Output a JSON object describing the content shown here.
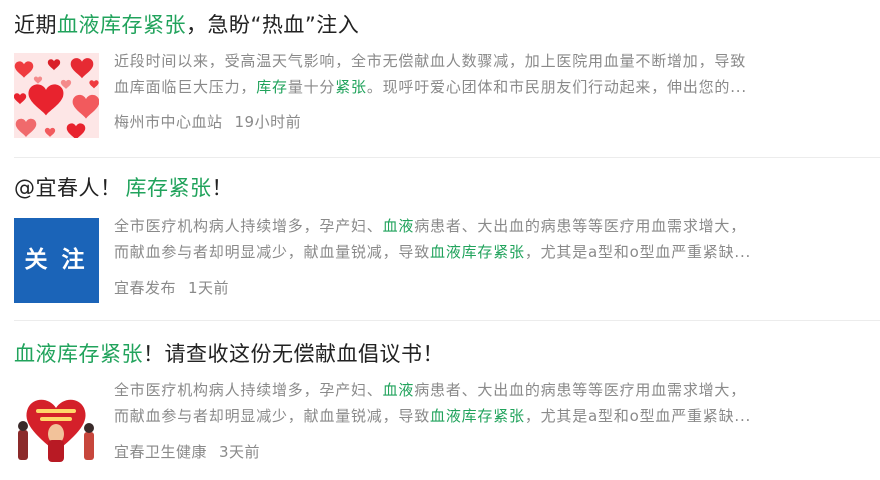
{
  "items": [
    {
      "title_pre": "近期",
      "title_hl": "血液库存紧张",
      "title_post": "，急盼“热血”注入",
      "snippet_line1": "近段时间以来，受高温天气影响，全市无偿献血人数骤减，加上医院用血量不断增加，导致",
      "snippet_line2_a": "血库面临巨大压力，",
      "snippet_line2_hl1": "库存",
      "snippet_line2_b": "量十分",
      "snippet_line2_hl2": "紧张",
      "snippet_line2_c": "。现呼吁爱心团体和市民朋友们行动起来，伸出您的...",
      "source": "梅州市中心血站",
      "time": "19小时前",
      "thumb_icon": "hearts-image"
    },
    {
      "title_pre": "@宜春人！",
      "title_hl": "库存紧张",
      "title_post": "！",
      "snippet_line1_a": "全市医疗机构病人持续增多，孕产妇、",
      "snippet_line1_hl": "血液",
      "snippet_line1_b": "病患者、大出血的病患等等医疗用血需求增大，",
      "snippet_line2_a": "而献血参与者却明显减少，献血量锐减，导致",
      "snippet_line2_hl": "血液库存紧张",
      "snippet_line2_b": "，尤其是a型和o型血严重紧缺...",
      "source": "宜春发布",
      "time": "1天前",
      "thumb_text": "关注",
      "thumb_color": "#1b64b8"
    },
    {
      "title_hl": "血液库存紧张",
      "title_post": "！请查收这份无偿献血倡议书！",
      "snippet_line1_a": "全市医疗机构病人持续增多，孕产妇、",
      "snippet_line1_hl": "血液",
      "snippet_line1_b": "病患者、大出血的病患等等医疗用血需求增大，",
      "snippet_line2_a": "而献血参与者却明显减少，献血量锐减，导致",
      "snippet_line2_hl": "血液库存紧张",
      "snippet_line2_b": "，尤其是a型和o型血严重紧缺...",
      "source": "宜春卫生健康",
      "time": "3天前",
      "thumb_icon": "blood-donation-poster"
    }
  ],
  "colors": {
    "highlight": "#21a35c",
    "title": "#222222",
    "muted": "#8a8a8a",
    "separator": "#ececec"
  }
}
